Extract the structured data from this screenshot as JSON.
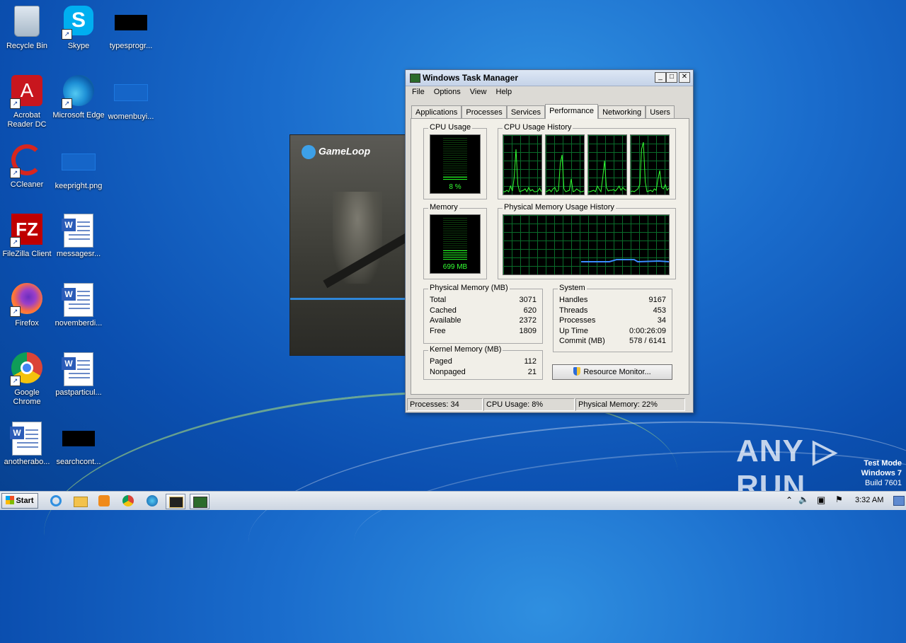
{
  "desktop": {
    "icons": [
      {
        "label": "Recycle Bin"
      },
      {
        "label": "Skype"
      },
      {
        "label": "typesprogr..."
      },
      {
        "label": "Acrobat Reader DC"
      },
      {
        "label": "Microsoft Edge"
      },
      {
        "label": "womenbuyi..."
      },
      {
        "label": "CCleaner"
      },
      {
        "label": "keepright.png"
      },
      {
        "label": "FileZilla Client"
      },
      {
        "label": "messagesr..."
      },
      {
        "label": "Firefox"
      },
      {
        "label": "novemberdi..."
      },
      {
        "label": "Google Chrome"
      },
      {
        "label": "pastparticul..."
      },
      {
        "label": "anotherabo..."
      },
      {
        "label": "searchcont..."
      }
    ],
    "icon_glyphs": {
      "skype": "S",
      "acrobat": "A",
      "filezilla": "FZ",
      "word": "W"
    }
  },
  "gameloop": {
    "logo_text": "GameLoop"
  },
  "task_manager": {
    "title": "Windows Task Manager",
    "window_buttons": {
      "minimize": "_",
      "maximize": "□",
      "close": "✕"
    },
    "menu": [
      "File",
      "Options",
      "View",
      "Help"
    ],
    "tabs": [
      "Applications",
      "Processes",
      "Services",
      "Performance",
      "Networking",
      "Users"
    ],
    "active_tab": "Performance",
    "cpu_usage": {
      "title": "CPU Usage",
      "value": "8 %",
      "percent": 8
    },
    "cpu_history": {
      "title": "CPU Usage History"
    },
    "memory": {
      "title": "Memory",
      "value": "699 MB",
      "fraction": 0.23
    },
    "memory_history": {
      "title": "Physical Memory Usage History"
    },
    "physical_memory": {
      "title": "Physical Memory (MB)",
      "rows": [
        {
          "k": "Total",
          "v": "3071"
        },
        {
          "k": "Cached",
          "v": "620"
        },
        {
          "k": "Available",
          "v": "2372"
        },
        {
          "k": "Free",
          "v": "1809"
        }
      ]
    },
    "kernel_memory": {
      "title": "Kernel Memory (MB)",
      "rows": [
        {
          "k": "Paged",
          "v": "112"
        },
        {
          "k": "Nonpaged",
          "v": "21"
        }
      ]
    },
    "system": {
      "title": "System",
      "rows": [
        {
          "k": "Handles",
          "v": "9167"
        },
        {
          "k": "Threads",
          "v": "453"
        },
        {
          "k": "Processes",
          "v": "34"
        },
        {
          "k": "Up Time",
          "v": "0:00:26:09"
        },
        {
          "k": "Commit (MB)",
          "v": "578 / 6141"
        }
      ]
    },
    "resource_monitor_label": "Resource Monitor...",
    "status": {
      "processes": "Processes: 34",
      "cpu": "CPU Usage: 8%",
      "memory": "Physical Memory: 22%"
    },
    "colors": {
      "graph_line": "#33ff33",
      "memory_line": "#3a8bff",
      "grid": "#0a6b2a"
    }
  },
  "watermark": {
    "brand": "ANY ▷ RUN",
    "test_mode": "Test Mode",
    "os": "Windows 7",
    "build": "Build 7601"
  },
  "taskbar": {
    "start_label": "Start",
    "clock": "3:32 AM",
    "tray_glyphs": {
      "chevron": "⌃",
      "volume": "🔈",
      "network": "▣",
      "flag": "⚑"
    }
  }
}
